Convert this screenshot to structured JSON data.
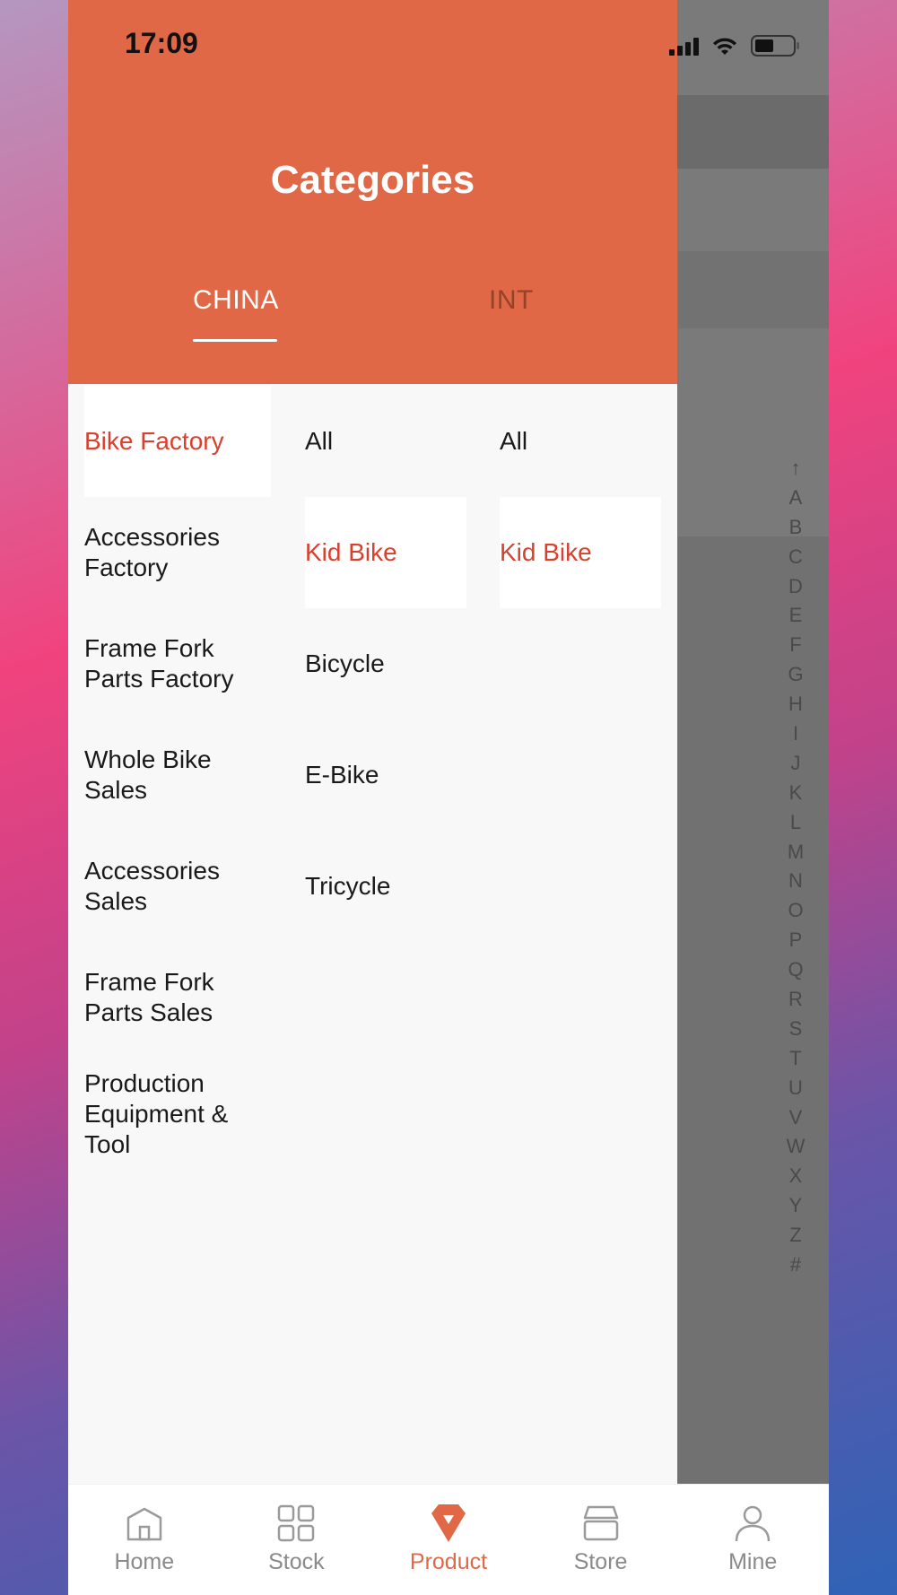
{
  "status_bar": {
    "time": "17:09"
  },
  "drawer": {
    "title": "Categories",
    "tabs": [
      {
        "label": "CHINA",
        "active": true
      },
      {
        "label": "INT",
        "active": false
      }
    ]
  },
  "categories": {
    "level1": [
      {
        "label": "Bike Factory",
        "active": true
      },
      {
        "label": "Accessories Factory"
      },
      {
        "label": "Frame Fork Parts Factory"
      },
      {
        "label": "Whole Bike Sales"
      },
      {
        "label": "Accessories Sales"
      },
      {
        "label": "Frame Fork Parts Sales"
      },
      {
        "label": "Production Equipment & Tool"
      }
    ],
    "level2": [
      {
        "label": "All"
      },
      {
        "label": "Kid Bike",
        "active": true
      },
      {
        "label": "Bicycle"
      },
      {
        "label": "E-Bike"
      },
      {
        "label": "Tricycle"
      }
    ],
    "level3": [
      {
        "label": "All"
      },
      {
        "label": "Kid Bike",
        "active": true
      }
    ]
  },
  "alpha_index": [
    "↑",
    "A",
    "B",
    "C",
    "D",
    "E",
    "F",
    "G",
    "H",
    "I",
    "J",
    "K",
    "L",
    "M",
    "N",
    "O",
    "P",
    "Q",
    "R",
    "S",
    "T",
    "U",
    "V",
    "W",
    "X",
    "Y",
    "Z",
    "#"
  ],
  "tabbar": {
    "items": [
      {
        "label": "Home",
        "icon": "home-icon"
      },
      {
        "label": "Stock",
        "icon": "grid-icon"
      },
      {
        "label": "Product",
        "icon": "diamond-icon",
        "active": true
      },
      {
        "label": "Store",
        "icon": "store-icon"
      },
      {
        "label": "Mine",
        "icon": "person-icon"
      }
    ]
  },
  "colors": {
    "accent": "#e06847",
    "active_text": "#d7412d"
  }
}
